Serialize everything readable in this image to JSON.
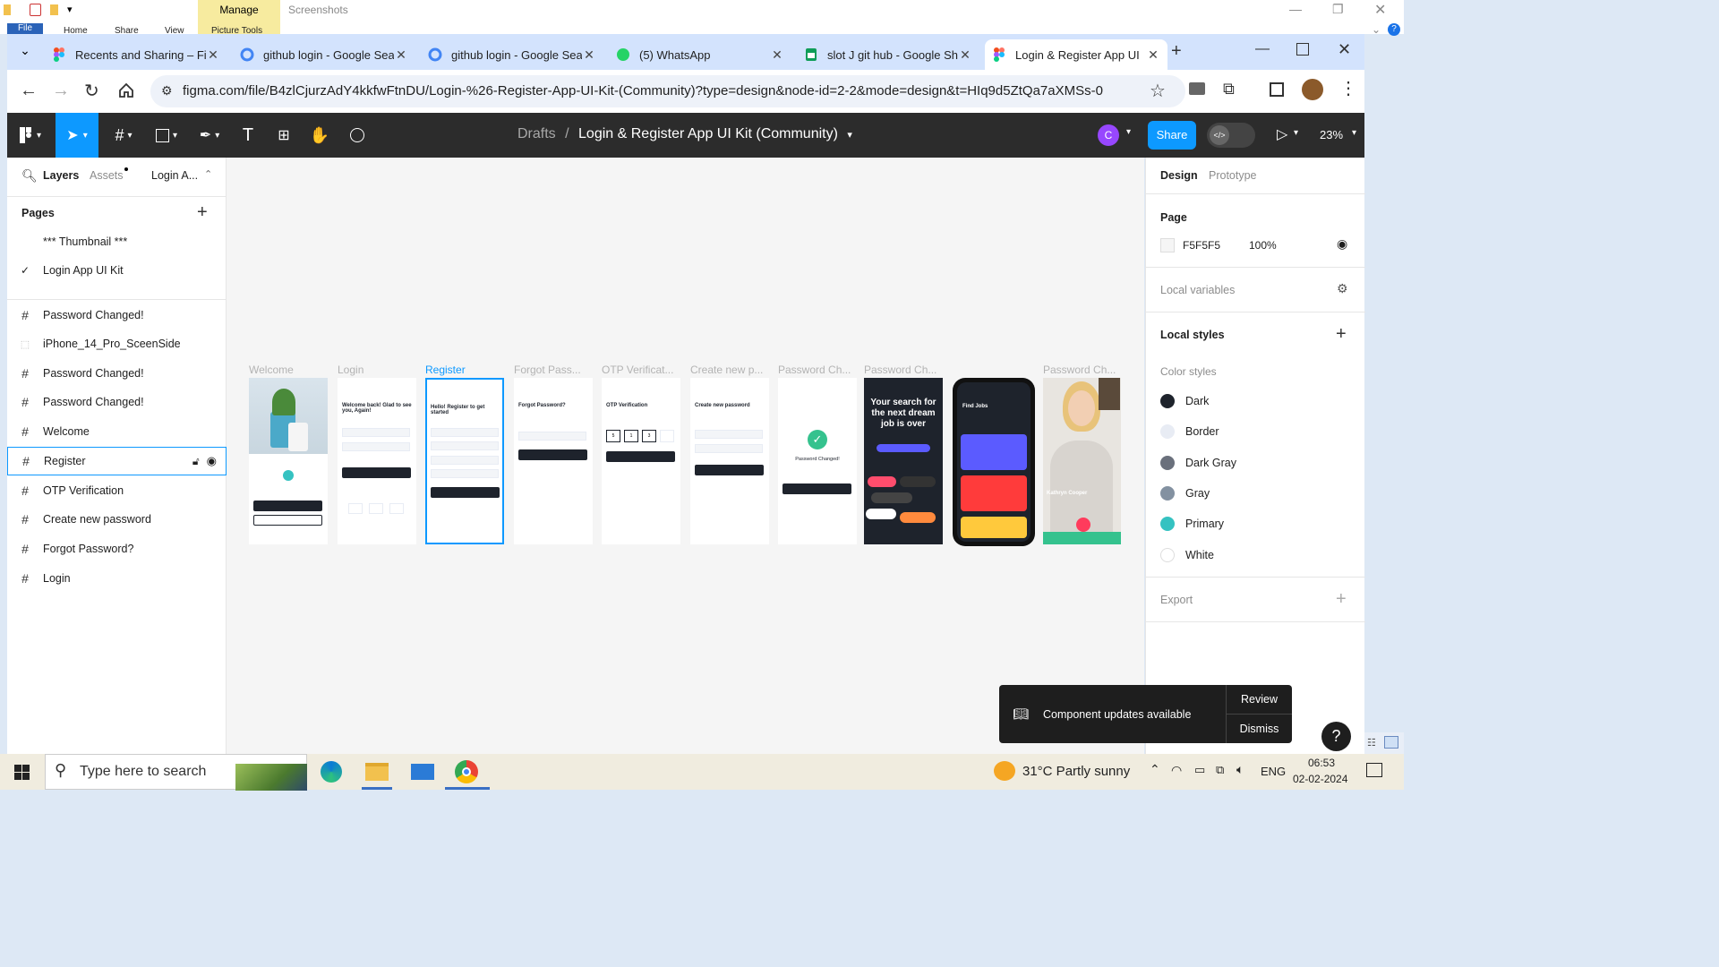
{
  "explorer": {
    "manage": "Manage",
    "screenshots": "Screenshots",
    "file": "File",
    "tabs": [
      "Home",
      "Share",
      "View",
      "Picture Tools"
    ]
  },
  "browser": {
    "tabs": [
      {
        "title": "Recents and Sharing – Fig",
        "icon": "figma-icon"
      },
      {
        "title": "github login - Google Sea",
        "icon": "google-icon"
      },
      {
        "title": "github login - Google Sea",
        "icon": "google-icon"
      },
      {
        "title": "(5) WhatsApp",
        "icon": "whatsapp-icon"
      },
      {
        "title": "slot J git hub - Google Sh",
        "icon": "sheets-icon"
      },
      {
        "title": "Login & Register App UI",
        "icon": "figma-icon"
      }
    ],
    "url": "figma.com/file/B4zlCjurzAdY4kkfwFtnDU/Login-%26-Register-App-UI-Kit-(Community)?type=design&node-id=2-2&mode=design&t=HIq9d5ZtQa7aXMSs-0"
  },
  "toolbar": {
    "crumb_root": "Drafts",
    "crumb_sep": "/",
    "file_title": "Login & Register App UI Kit (Community)",
    "avatar": "C",
    "share": "Share",
    "zoom": "23%"
  },
  "left": {
    "tabs": {
      "layers": "Layers",
      "assets": "Assets",
      "page_name": "Login A..."
    },
    "pages_title": "Pages",
    "pages": [
      "*** Thumbnail ***",
      "Login App UI Kit"
    ],
    "layers": [
      "Password Changed!",
      "iPhone_14_Pro_SceenSide",
      "Password Changed!",
      "Password Changed!",
      "Welcome",
      "Register",
      "OTP Verification",
      "Create new password",
      "Forgot Password?",
      "Login"
    ]
  },
  "canvas": {
    "frames": [
      "Welcome",
      "Login",
      "Register",
      "Forgot Pass...",
      "OTP Verificat...",
      "Create new p...",
      "Password Ch...",
      "Password Ch...",
      "",
      "Password Ch..."
    ],
    "login_text": "Welcome back! Glad to see you, Again!",
    "register_text": "Hello! Register to get started",
    "forgot_text": "Forgot Password?",
    "otp_text": "OTP Verification",
    "create_text": "Create new password",
    "changed_text": "Password Changed!",
    "dream_text": "Your search for the next dream job is over",
    "findjobs_text": "Find Jobs",
    "person_name": "Kathryn Cooper",
    "otp_digits": [
      "5",
      "1",
      "3",
      ""
    ]
  },
  "right": {
    "tabs": {
      "design": "Design",
      "prototype": "Prototype"
    },
    "page_label": "Page",
    "page_color": "F5F5F5",
    "page_opacity": "100%",
    "local_variables": "Local variables",
    "local_styles": "Local styles",
    "color_styles_label": "Color styles",
    "color_styles": [
      {
        "name": "Dark",
        "color": "#1E232C"
      },
      {
        "name": "Border",
        "color": "#E8ECF4"
      },
      {
        "name": "Dark Gray",
        "color": "#6A707C"
      },
      {
        "name": "Gray",
        "color": "#8391A1"
      },
      {
        "name": "Primary",
        "color": "#35C2C1"
      },
      {
        "name": "White",
        "color": "#FFFFFF"
      }
    ],
    "export": "Export"
  },
  "toast": {
    "text": "Component updates available",
    "review": "Review",
    "dismiss": "Dismiss"
  },
  "help": "?",
  "taskbar": {
    "search": "Type here to search",
    "weather": "31°C  Partly sunny",
    "lang": "ENG",
    "time": "06:53",
    "date": "02-02-2024"
  }
}
